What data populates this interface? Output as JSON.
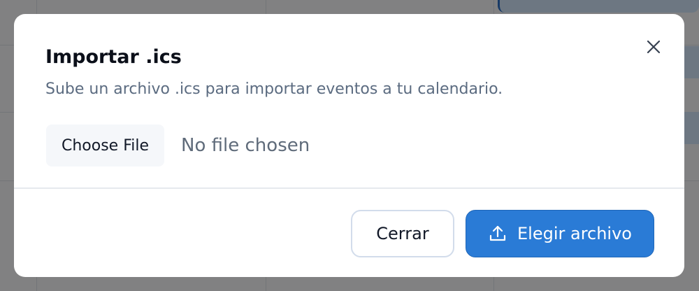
{
  "background": {
    "event_labels": [
      "id",
      "id"
    ]
  },
  "dialog": {
    "title": "Importar .ics",
    "description": "Sube un archivo .ics para importar eventos a tu calendario.",
    "file_input": {
      "button_label": "Choose File",
      "status": "No file chosen"
    },
    "close_icon": "close-icon",
    "footer": {
      "cancel_label": "Cerrar",
      "primary_label": "Elegir archivo",
      "primary_icon": "upload-icon"
    }
  },
  "colors": {
    "primary": "#2a7bd6",
    "overlay": "#000000",
    "title": "#0b0f19",
    "muted": "#5b6b80"
  }
}
